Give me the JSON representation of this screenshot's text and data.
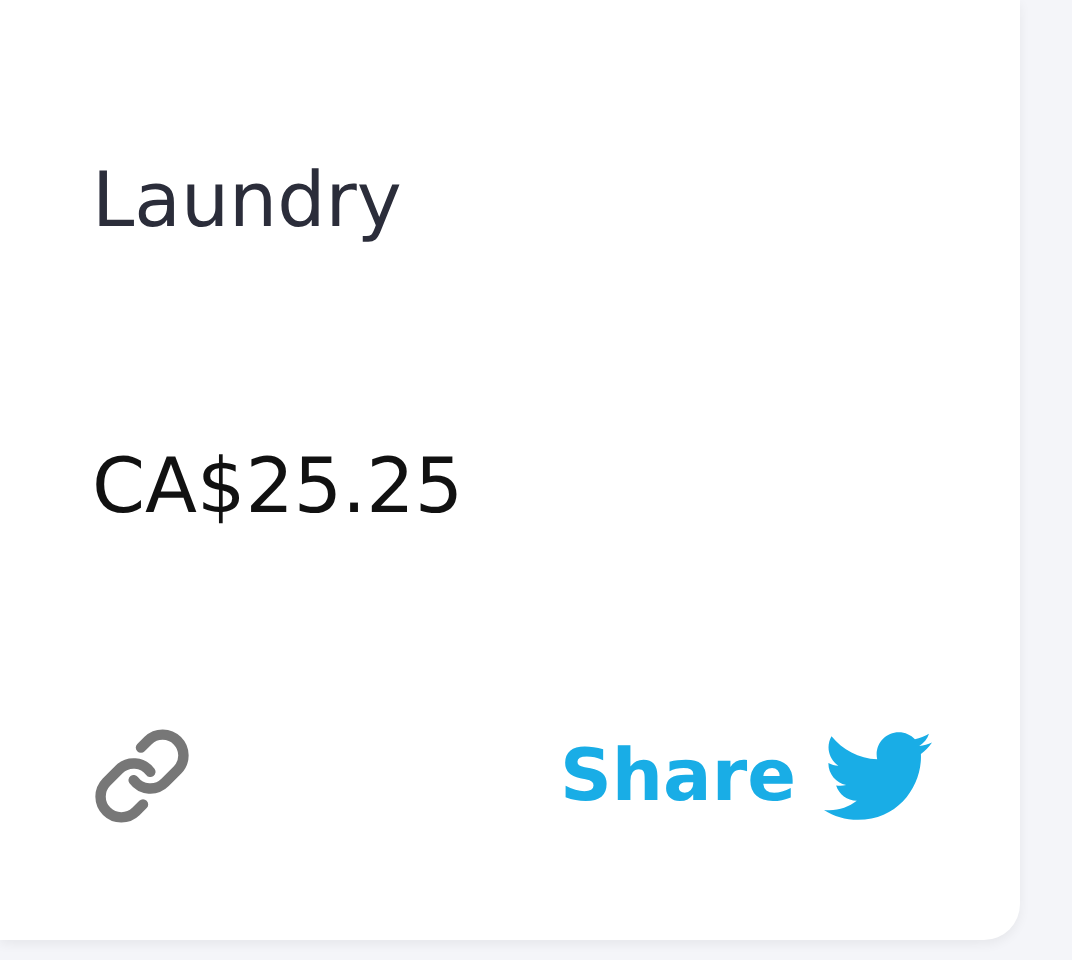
{
  "card": {
    "title": "Laundry",
    "price": "CA$25.25",
    "share": {
      "label": "Share"
    }
  }
}
